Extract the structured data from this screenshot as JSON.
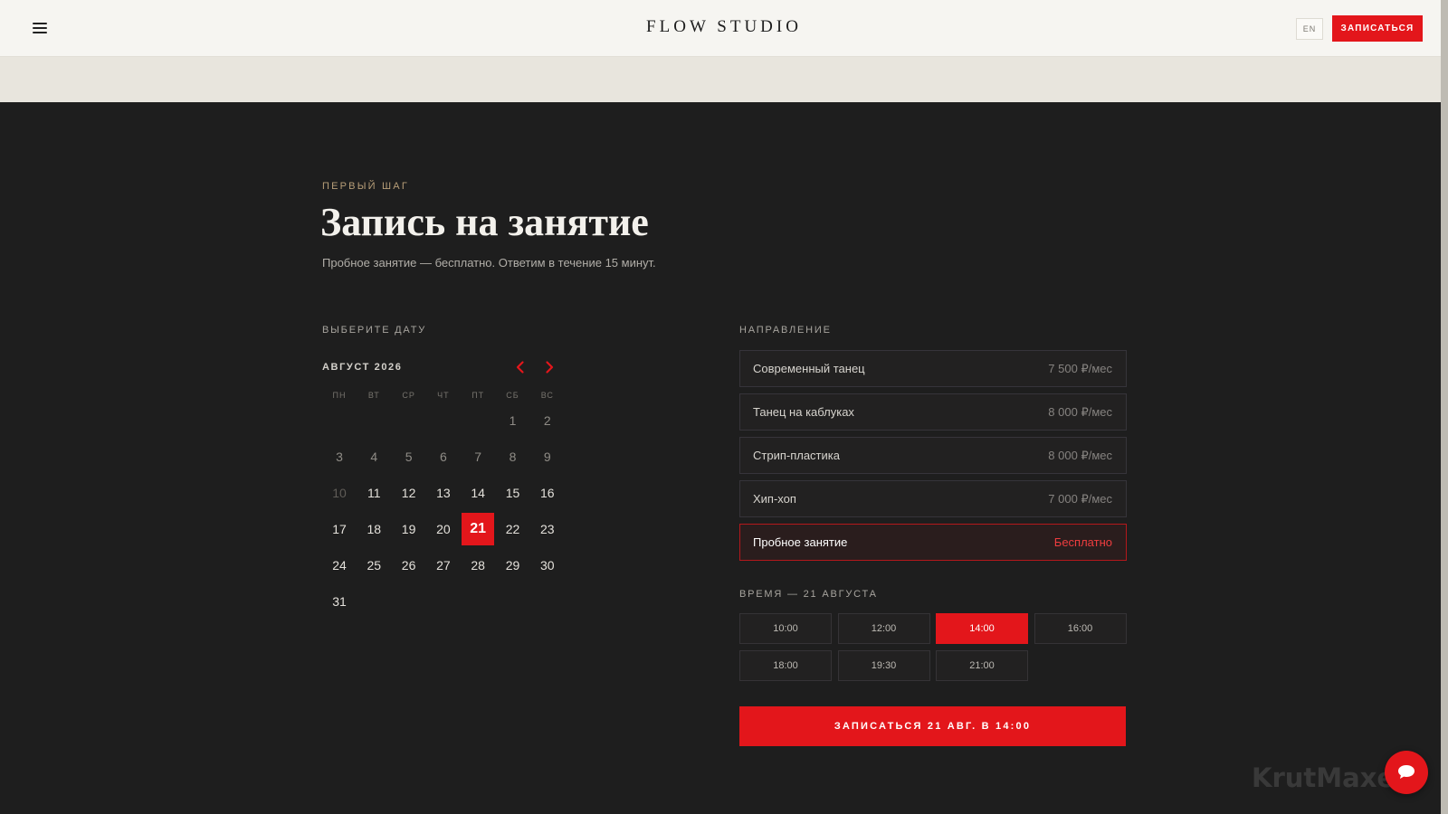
{
  "header": {
    "brand": "FLOW STUDIO",
    "lang": "EN",
    "signup": "ЗАПИСАТЬСЯ"
  },
  "hero": {
    "eyebrow": "ПЕРВЫЙ ШАГ",
    "title": "Запись на занятие",
    "subtitle": "Пробное занятие — бесплатно. Ответим в течение 15 минут."
  },
  "calendar": {
    "section_label": "ВЫБЕРИТЕ ДАТУ",
    "month": "АВГУСТ 2026",
    "weekdays": [
      "ПН",
      "ВТ",
      "СР",
      "ЧТ",
      "ПТ",
      "СБ",
      "ВС"
    ],
    "days": [
      "1",
      "2",
      "3",
      "4",
      "5",
      "6",
      "7",
      "8",
      "9",
      "10",
      "11",
      "12",
      "13",
      "14",
      "15",
      "16",
      "17",
      "18",
      "19",
      "20",
      "21",
      "22",
      "23",
      "24",
      "25",
      "26",
      "27",
      "28",
      "29",
      "30",
      "31"
    ],
    "selected_day": "21"
  },
  "directions": {
    "section_label": "НАПРАВЛЕНИЕ",
    "items": [
      {
        "name": "Современный танец",
        "price": "7 500 ₽/мес"
      },
      {
        "name": "Танец на каблуках",
        "price": "8 000 ₽/мес"
      },
      {
        "name": "Стрип-пластика",
        "price": "8 000 ₽/мес"
      },
      {
        "name": "Хип-хоп",
        "price": "7 000 ₽/мес"
      },
      {
        "name": "Пробное занятие",
        "price": "Бесплатно"
      }
    ],
    "selected": "Пробное занятие"
  },
  "time": {
    "section_label": "ВРЕМЯ — 21 АВГУСТА",
    "slots": [
      "10:00",
      "12:00",
      "14:00",
      "16:00",
      "18:00",
      "19:30",
      "21:00"
    ],
    "selected": "14:00"
  },
  "submit": "ЗАПИСАТЬСЯ 21 АВГ. В 14:00",
  "watermark": "KrutMaxer",
  "colors": {
    "accent": "#e3161b",
    "background": "#1e1e1e",
    "header_bg": "#f6f5f1",
    "eyebrow": "#b79e78"
  },
  "icons": {
    "menu": "hamburger-menu-icon",
    "prev": "chevron-left-icon",
    "next": "chevron-right-icon",
    "chat": "chat-bubble-icon"
  }
}
